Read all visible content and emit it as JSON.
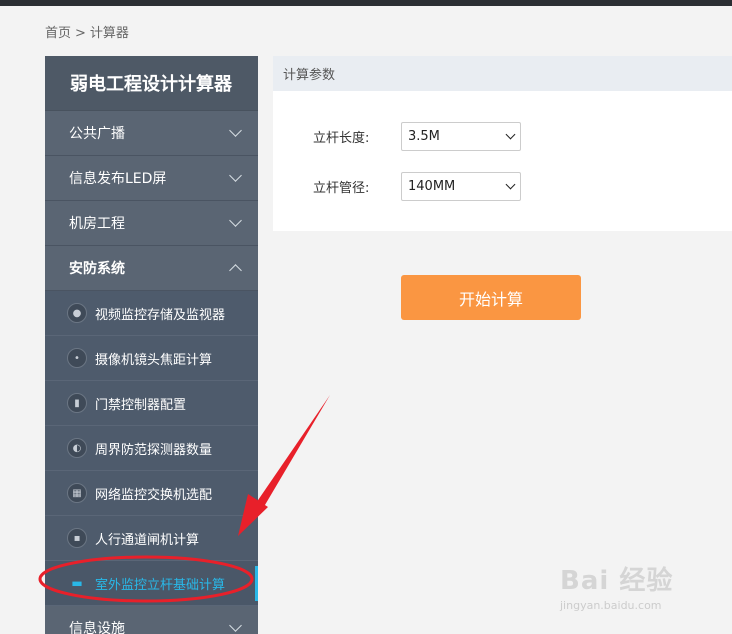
{
  "breadcrumb": {
    "home": "首页",
    "sep": ">",
    "current": "计算器"
  },
  "sidebar": {
    "title": "弱电工程设计计算器",
    "groups": [
      {
        "label": "公共广播",
        "state": "collapsed"
      },
      {
        "label": "信息发布LED屏",
        "state": "collapsed"
      },
      {
        "label": "机房工程",
        "state": "collapsed"
      },
      {
        "label": "安防系统",
        "state": "expanded"
      }
    ],
    "items": [
      {
        "label": "视频监控存储及监视器",
        "icon": "camera-icon"
      },
      {
        "label": "摄像机镜头焦距计算",
        "icon": "lens-icon"
      },
      {
        "label": "门禁控制器配置",
        "icon": "door-controller-icon"
      },
      {
        "label": "周界防范探测器数量",
        "icon": "detector-icon"
      },
      {
        "label": "网络监控交换机选配",
        "icon": "switch-icon"
      },
      {
        "label": "人行通道闸机计算",
        "icon": "turnstile-icon"
      },
      {
        "label": "室外监控立杆基础计算",
        "icon": "pole-icon",
        "active": true
      }
    ],
    "bottom_group": {
      "label": "信息设施",
      "state": "collapsed"
    }
  },
  "panel": {
    "header": "计算参数",
    "pole_length": {
      "label": "立杆长度:",
      "value": "3.5M"
    },
    "pole_diameter": {
      "label": "立杆管径:",
      "value": "140MM"
    }
  },
  "calc_button": {
    "label": "开始计算",
    "color": "#fa9642"
  },
  "watermark": {
    "logo": "Bai 经验",
    "url": "jingyan.baidu.com"
  },
  "colors": {
    "accent": "#29b8e8",
    "sidebar": "#55606e",
    "annotation": "#e8202a"
  }
}
